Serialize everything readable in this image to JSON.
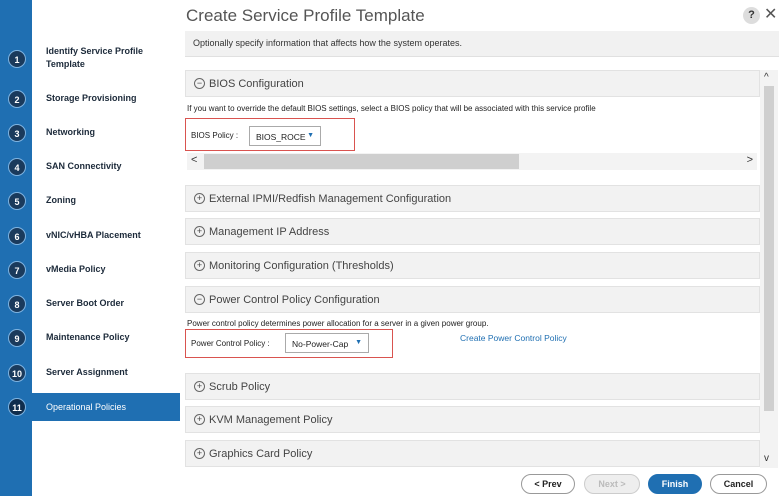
{
  "dialog": {
    "title": "Create Service Profile Template",
    "help": "?",
    "close": "✕",
    "info": "Optionally specify information that affects how the system operates."
  },
  "steps": [
    {
      "num": "1",
      "label": "Identify Service Profile Template"
    },
    {
      "num": "2",
      "label": "Storage Provisioning"
    },
    {
      "num": "3",
      "label": "Networking"
    },
    {
      "num": "4",
      "label": "SAN Connectivity"
    },
    {
      "num": "5",
      "label": "Zoning"
    },
    {
      "num": "6",
      "label": "vNIC/vHBA Placement"
    },
    {
      "num": "7",
      "label": "vMedia Policy"
    },
    {
      "num": "8",
      "label": "Server Boot Order"
    },
    {
      "num": "9",
      "label": "Maintenance Policy"
    },
    {
      "num": "10",
      "label": "Server Assignment"
    },
    {
      "num": "11",
      "label": "Operational Policies",
      "active": true
    }
  ],
  "sections": {
    "bios": {
      "title": "BIOS Configuration",
      "toggle": "−",
      "desc": "If you want to override the default BIOS settings, select a BIOS policy that will be associated with this service profile",
      "field_label": "BIOS Policy :",
      "value": "BIOS_ROCE",
      "caret": "▼"
    },
    "ipmi": {
      "title": "External IPMI/Redfish Management Configuration",
      "toggle": "+"
    },
    "mgmt_ip": {
      "title": "Management IP Address",
      "toggle": "+"
    },
    "monitoring": {
      "title": "Monitoring Configuration (Thresholds)",
      "toggle": "+"
    },
    "power": {
      "title": "Power Control Policy Configuration",
      "toggle": "−",
      "desc": "Power control policy determines power allocation for a server in a given power group.",
      "field_label": "Power Control Policy :",
      "value": "No-Power-Cap",
      "caret": "▼",
      "link": "Create Power Control Policy"
    },
    "scrub": {
      "title": "Scrub Policy",
      "toggle": "+"
    },
    "kvm": {
      "title": "KVM Management Policy",
      "toggle": "+"
    },
    "graphics": {
      "title": "Graphics Card Policy",
      "toggle": "+"
    }
  },
  "scroll": {
    "left": "<",
    "right": ">",
    "up": "^",
    "down": "v"
  },
  "footer": {
    "prev": "< Prev",
    "next": "Next >",
    "finish": "Finish",
    "cancel": "Cancel"
  }
}
